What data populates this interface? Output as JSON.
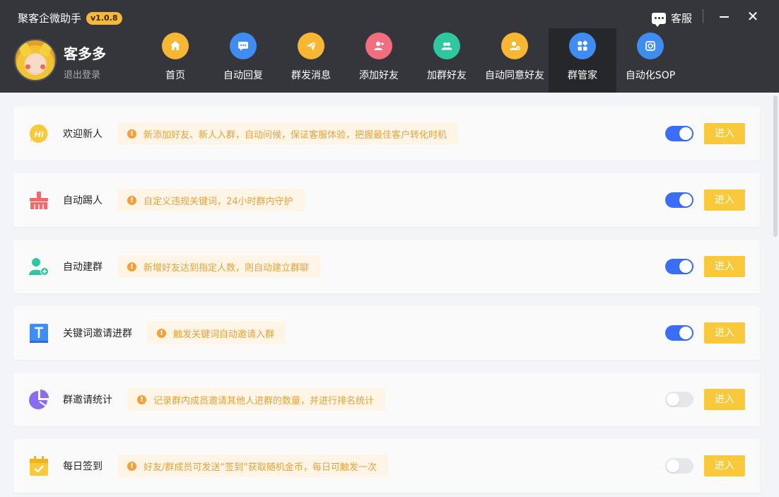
{
  "app": {
    "title": "聚客企微助手",
    "version": "v1.0.8"
  },
  "window": {
    "service_label": "客服",
    "close_glyph": "✕"
  },
  "user": {
    "name": "客多多",
    "logout": "退出登录"
  },
  "nav": [
    {
      "label": "首页",
      "icon": "home-icon",
      "color": "#f7b733"
    },
    {
      "label": "自动回复",
      "icon": "chat-icon",
      "color": "#3f8cf3"
    },
    {
      "label": "群发消息",
      "icon": "send-icon",
      "color": "#f7b733"
    },
    {
      "label": "添加好友",
      "icon": "add-user-icon",
      "color": "#f26d7d"
    },
    {
      "label": "加群好友",
      "icon": "group-icon",
      "color": "#2fc7a0"
    },
    {
      "label": "自动同意好友",
      "icon": "agree-user-icon",
      "color": "#f7b733"
    },
    {
      "label": "群管家",
      "icon": "apps-icon",
      "color": "#3f8cf3",
      "active": true
    },
    {
      "label": "自动化SOP",
      "icon": "sop-icon",
      "color": "#3f8cf3"
    }
  ],
  "features": [
    {
      "title": "欢迎新人",
      "tip": "新添加好友、新人入群，自动问候，保证客服体验，把握最佳客户转化时机",
      "enabled": true,
      "button": "进入",
      "icon": "hi-bubble-icon",
      "color": "#f8c93a"
    },
    {
      "title": "自动踢人",
      "tip": "自定义违规关键词，24小时群内守护",
      "enabled": true,
      "button": "进入",
      "icon": "broom-icon",
      "color": "#f06a6a"
    },
    {
      "title": "自动建群",
      "tip": "新增好友达到指定人数，则自动建立群聊",
      "enabled": true,
      "button": "进入",
      "icon": "add-group-icon",
      "color": "#2fc7a0"
    },
    {
      "title": "关键词邀请进群",
      "tip": "触发关键词自动邀请入群",
      "enabled": true,
      "button": "进入",
      "icon": "text-t-icon",
      "color": "#3f8cf3"
    },
    {
      "title": "群邀请统计",
      "tip": "记录群内成员邀请其他人进群的数量，并进行排名统计",
      "enabled": false,
      "button": "进入",
      "icon": "pie-chart-icon",
      "color": "#8b6cf0"
    },
    {
      "title": "每日签到",
      "tip": "好友/群成员可发送“签到”获取随机金币，每日可触发一次",
      "enabled": false,
      "button": "进入",
      "icon": "calendar-check-icon",
      "color": "#f8c93a"
    }
  ]
}
